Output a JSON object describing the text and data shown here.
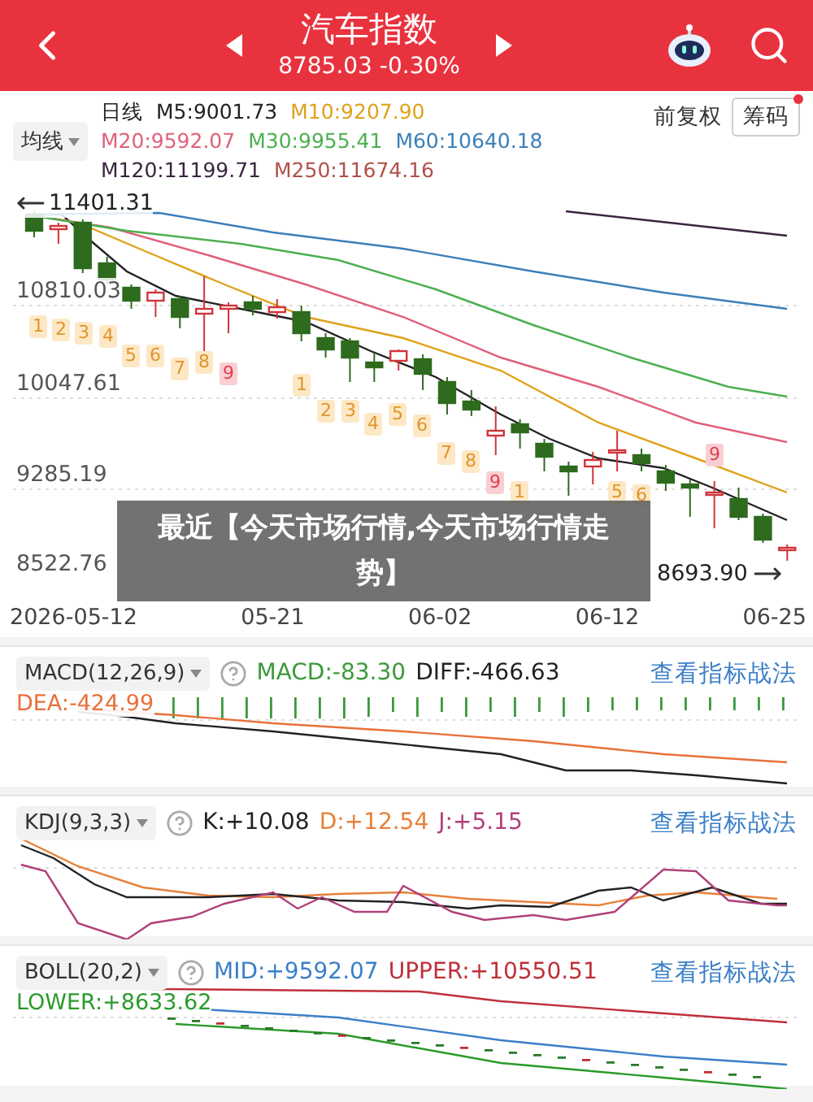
{
  "header": {
    "title": "汽车指数",
    "quote": "8785.03 -0.30%"
  },
  "ma_bar": {
    "selector": "均线",
    "rows": [
      [
        {
          "text": "日线",
          "color": "#222222"
        },
        {
          "text": "M5:9001.73",
          "color": "#222222"
        },
        {
          "text": "M10:9207.90",
          "color": "#e0a21a"
        }
      ],
      [
        {
          "text": "M20:9592.07",
          "color": "#e0607a"
        },
        {
          "text": "M30:9955.41",
          "color": "#4caf50"
        },
        {
          "text": "M60:10640.18",
          "color": "#3b7fb8"
        }
      ],
      [
        {
          "text": "M120:11199.71",
          "color": "#3a2440"
        },
        {
          "text": "M250:11674.16",
          "color": "#b0504a"
        }
      ]
    ],
    "adjust": "前复权",
    "chips_button": "筹码",
    "chips_dot": true
  },
  "chart": {
    "high_label": "11401.31",
    "y_labels": [
      "10810.03",
      "10047.61",
      "9285.19",
      "8522.76"
    ],
    "low_label": "8693.90",
    "x_labels": [
      "2026-05-12",
      "05-21",
      "06-02",
      "06-12",
      "06-25"
    ],
    "td_marks": [
      {
        "label": "1",
        "color": "#e0952a"
      },
      {
        "label": "2",
        "color": "#e0952a"
      },
      {
        "label": "3",
        "color": "#e0952a"
      },
      {
        "label": "4",
        "color": "#e0952a"
      },
      {
        "label": "5",
        "color": "#e0952a"
      },
      {
        "label": "6",
        "color": "#e0952a"
      },
      {
        "label": "7",
        "color": "#e0952a"
      },
      {
        "label": "8",
        "color": "#e0952a"
      },
      {
        "label": "9",
        "color": "#e0404e"
      },
      {
        "label": "1",
        "color": "#e0952a"
      },
      {
        "label": "2",
        "color": "#e0952a"
      },
      {
        "label": "3",
        "color": "#e0952a"
      },
      {
        "label": "4",
        "color": "#e0952a"
      },
      {
        "label": "5",
        "color": "#e0952a"
      },
      {
        "label": "6",
        "color": "#e0952a"
      },
      {
        "label": "7",
        "color": "#e0952a"
      },
      {
        "label": "8",
        "color": "#e0952a"
      },
      {
        "label": "9",
        "color": "#e0404e"
      },
      {
        "label": "1",
        "color": "#e0952a"
      },
      {
        "label": "5",
        "color": "#e0952a"
      },
      {
        "label": "6",
        "color": "#e0952a"
      },
      {
        "label": "9",
        "color": "#e0404e"
      }
    ]
  },
  "banner": "最近【今天市场行情,今天市场行情走势】",
  "indicators": [
    {
      "kind": "macd",
      "selector": "MACD(12,26,9)",
      "values": [
        {
          "text": "MACD:-83.30",
          "color": "#3a9a3a"
        },
        {
          "text": "DIFF:-466.63",
          "color": "#222222"
        }
      ],
      "link": "查看指标战法",
      "extra": {
        "text": "DEA:-424.99",
        "color": "#e8703a"
      }
    },
    {
      "kind": "kdj",
      "selector": "KDJ(9,3,3)",
      "values": [
        {
          "text": "K:+10.08",
          "color": "#222222"
        },
        {
          "text": "D:+12.54",
          "color": "#e8803a"
        },
        {
          "text": "J:+5.15",
          "color": "#b0407a"
        }
      ],
      "link": "查看指标战法"
    },
    {
      "kind": "boll",
      "selector": "BOLL(20,2)",
      "values": [
        {
          "text": "MID:+9592.07",
          "color": "#3b7fc8"
        },
        {
          "text": "UPPER:+10550.51",
          "color": "#c0303a"
        }
      ],
      "link": "查看指标战法",
      "extra": {
        "text": "LOWER:+8633.62",
        "color": "#2a9a2a"
      }
    }
  ]
}
